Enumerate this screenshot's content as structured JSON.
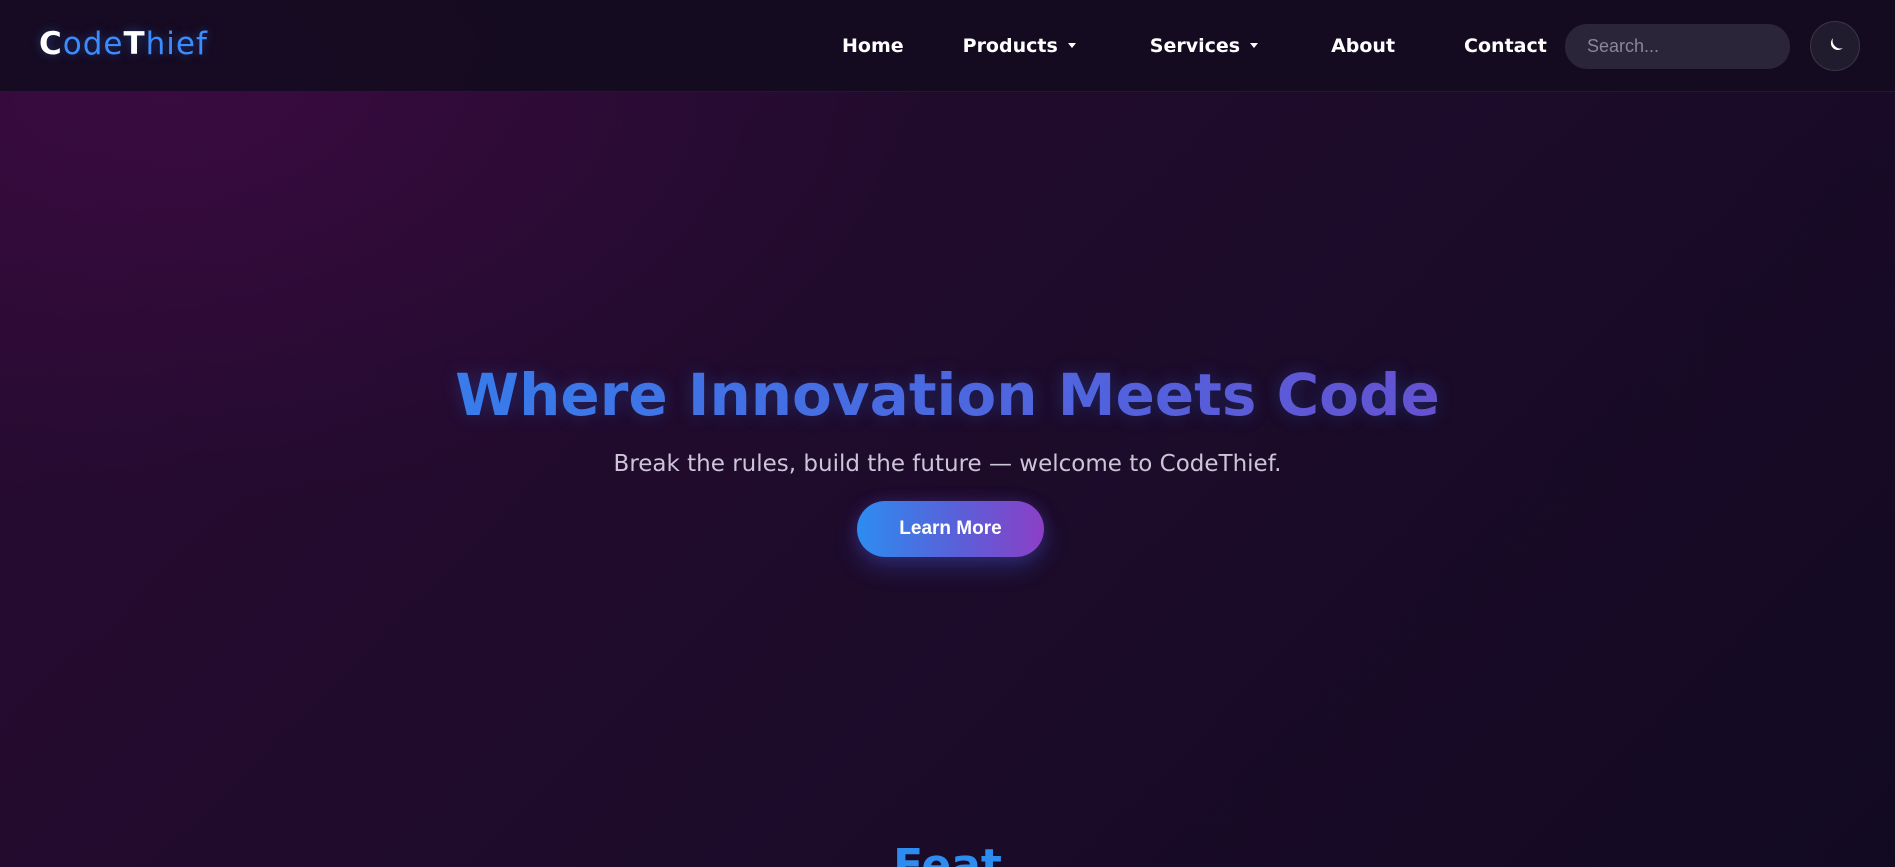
{
  "header": {
    "logo": {
      "parts": [
        {
          "text": "C",
          "style": "cap"
        },
        {
          "text": "ode",
          "style": "rest"
        },
        {
          "text": "T",
          "style": "cap"
        },
        {
          "text": "hief",
          "style": "rest"
        }
      ]
    },
    "nav": [
      {
        "label": "Home",
        "has_caret": false
      },
      {
        "label": "Products",
        "has_caret": true
      },
      {
        "label": "Services",
        "has_caret": true
      },
      {
        "label": "About",
        "has_caret": false
      },
      {
        "label": "Contact",
        "has_caret": false
      }
    ],
    "search": {
      "placeholder": "Search...",
      "icon": "search-icon"
    },
    "theme_toggle": {
      "icon": "moon-icon"
    }
  },
  "hero": {
    "title": "Where Innovation Meets Code",
    "subtitle": "Break the rules, build the future — welcome to CodeThief.",
    "cta_label": "Learn More",
    "colors": {
      "accent_start": "#2d8cf0",
      "accent_mid": "#5b5fd8",
      "accent_end": "#8a3fbe"
    }
  },
  "next_section": {
    "heading_partial": "Feat"
  }
}
